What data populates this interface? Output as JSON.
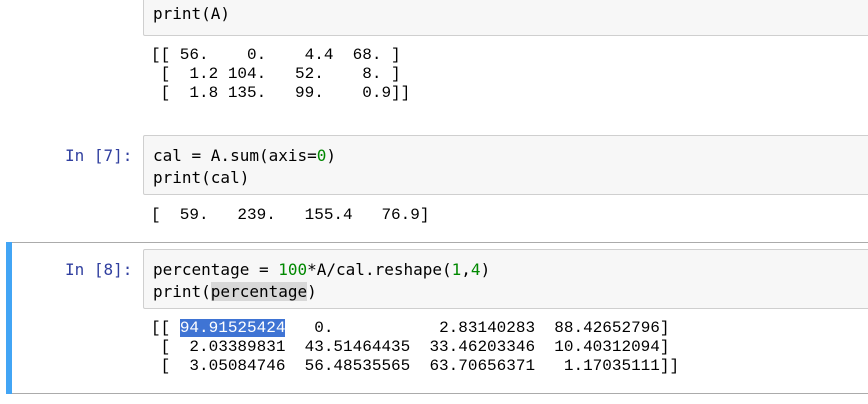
{
  "cells": [
    {
      "prompt": "",
      "code_lines": [
        "print(A)"
      ],
      "output_lines": [
        "[[ 56.    0.    4.4  68. ]",
        " [  1.2 104.   52.    8. ]",
        " [  1.8 135.   99.    0.9]]"
      ]
    },
    {
      "prompt": "In [7]:",
      "code_lines": [
        "cal = A.sum(axis=0)",
        "print(cal)"
      ],
      "output_lines": [
        "[  59.   239.   155.4   76.9]"
      ]
    },
    {
      "prompt": "In [8]:",
      "code_lines": [
        "percentage = 100*A/cal.reshape(1,4)",
        "print(percentage)"
      ],
      "output_lines": [
        "[[ 94.91525424   0.           2.83140283  88.42652796]",
        " [  2.03389831  43.51464435  33.46203346  10.40312094]",
        " [  3.05084746  56.48535565  63.70656371   1.17035111]]"
      ],
      "selected_text": "94.91525424"
    }
  ],
  "colors": {
    "prompt": "#303f9f",
    "selection": "#3f74d4",
    "selected_cell_bar": "#42a5f5",
    "input_bg": "#f7f7f7"
  }
}
